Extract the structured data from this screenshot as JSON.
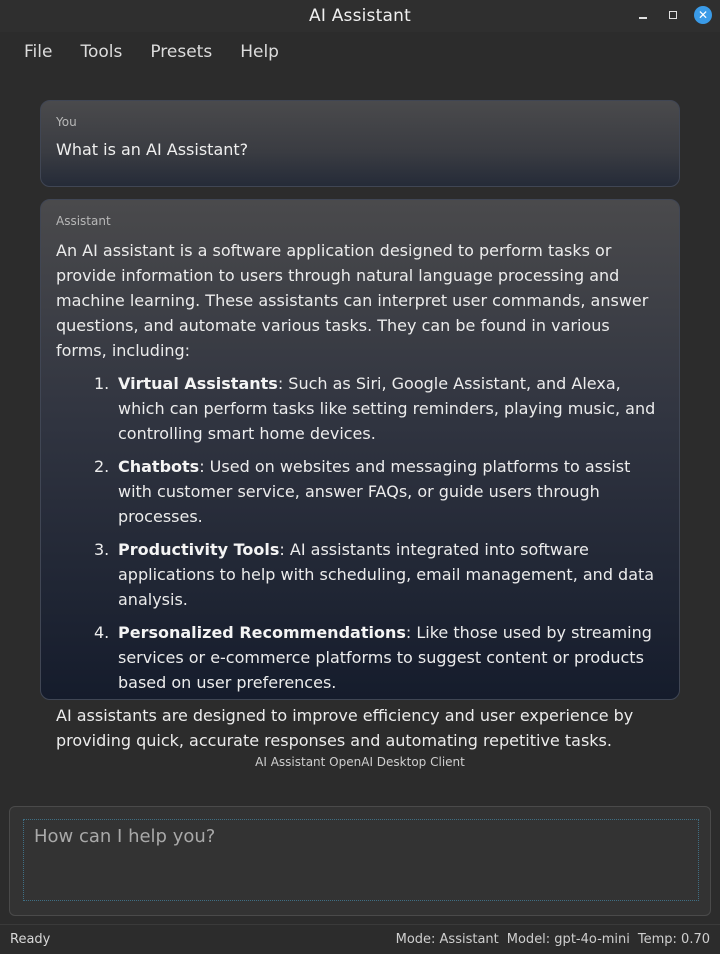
{
  "window": {
    "title": "AI Assistant"
  },
  "menu": {
    "items": [
      "File",
      "Tools",
      "Presets",
      "Help"
    ]
  },
  "chat": {
    "user": {
      "sender": "You",
      "message": "What is an AI Assistant?"
    },
    "assistant": {
      "sender": "Assistant",
      "intro": "An AI assistant is a software application designed to perform tasks or provide information to users through natural language processing and machine learning. These assistants can interpret user commands, answer questions, and automate various tasks. They can be found in various forms, including:",
      "list": [
        {
          "num": "1.",
          "term": "Virtual Assistants",
          "desc": ": Such as Siri, Google Assistant, and Alexa, which can perform tasks like setting reminders, playing music, and controlling smart home devices."
        },
        {
          "num": "2.",
          "term": "Chatbots",
          "desc": ": Used on websites and messaging platforms to assist with customer service, answer FAQs, or guide users through processes."
        },
        {
          "num": "3.",
          "term": "Productivity Tools",
          "desc": ": AI assistants integrated into software applications to help with scheduling, email management, and data analysis."
        },
        {
          "num": "4.",
          "term": "Personalized Recommendations",
          "desc": ": Like those used by streaming services or e-commerce platforms to suggest content or products based on user preferences."
        }
      ],
      "outro": "AI assistants are designed to improve efficiency and user experience by providing quick, accurate responses and automating repetitive tasks."
    }
  },
  "caption": "AI Assistant OpenAI Desktop Client",
  "input": {
    "placeholder": "How can I help you?"
  },
  "status": {
    "state": "Ready",
    "mode": "Mode: Assistant",
    "model": "Model: gpt-4o-mini",
    "temp": "Temp: 0.70"
  },
  "colors": {
    "close_button": "#3a9be8",
    "background": "#2c2c2c"
  },
  "icons": {
    "minimize": "minimize-icon",
    "maximize": "maximize-icon",
    "close": "close-icon"
  }
}
